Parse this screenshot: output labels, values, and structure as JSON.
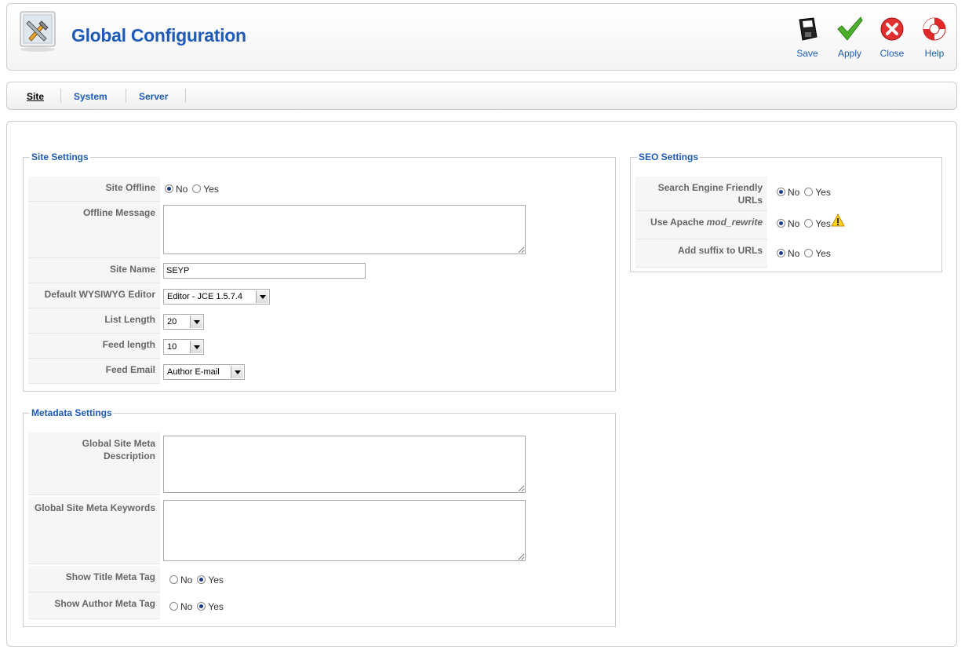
{
  "header": {
    "title": "Global Configuration"
  },
  "toolbar": {
    "save": "Save",
    "apply": "Apply",
    "close": "Close",
    "help": "Help"
  },
  "tabs": [
    "Site",
    "System",
    "Server"
  ],
  "site_settings": {
    "legend": "Site Settings",
    "site_offline": {
      "label": "Site Offline",
      "no": "No",
      "yes": "Yes",
      "selected": "No"
    },
    "offline_message": {
      "label": "Offline Message",
      "value": ""
    },
    "site_name": {
      "label": "Site Name",
      "value": "SEYP"
    },
    "editor": {
      "label": "Default WYSIWYG Editor",
      "value": "Editor - JCE 1.5.7.4"
    },
    "list_length": {
      "label": "List Length",
      "value": "20"
    },
    "feed_length": {
      "label": "Feed length",
      "value": "10"
    },
    "feed_email": {
      "label": "Feed Email",
      "value": "Author E-mail"
    }
  },
  "metadata_settings": {
    "legend": "Metadata Settings",
    "meta_description": {
      "label": "Global Site Meta Description",
      "value": ""
    },
    "meta_keywords": {
      "label": "Global Site Meta Keywords",
      "value": ""
    },
    "show_title": {
      "label": "Show Title Meta Tag",
      "no": "No",
      "yes": "Yes",
      "selected": "Yes"
    },
    "show_author": {
      "label": "Show Author Meta Tag",
      "no": "No",
      "yes": "Yes",
      "selected": "Yes"
    }
  },
  "seo_settings": {
    "legend": "SEO Settings",
    "sef_urls": {
      "label": "Search Engine Friendly URLs",
      "no": "No",
      "yes": "Yes",
      "selected": "No"
    },
    "mod_rewrite": {
      "label_prefix": "Use Apache ",
      "label_em": "mod_rewrite",
      "no": "No",
      "yes": "Yes",
      "selected": "No"
    },
    "suffix": {
      "label": "Add suffix to URLs",
      "no": "No",
      "yes": "Yes",
      "selected": "No"
    }
  }
}
